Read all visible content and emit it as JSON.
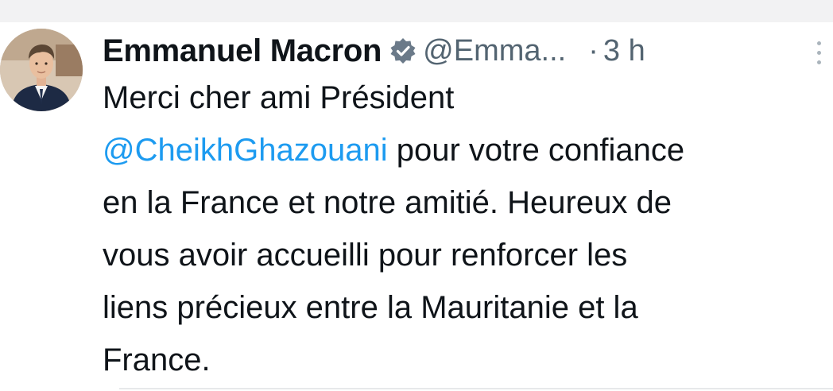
{
  "tweet": {
    "author": {
      "display_name": "Emmanuel Macron",
      "handle": "@Emma",
      "handle_ellipsis": "...",
      "verified": true
    },
    "separator": "·",
    "timestamp": "3 h",
    "text_lines": [
      "Merci cher ami Président",
      "pour votre confiance",
      "en la France et notre amitié. Heureux de",
      "vous avoir accueilli pour renforcer les",
      "liens précieux entre la Mauritanie et la",
      "France."
    ],
    "mention": "@CheikhGhazouani"
  },
  "colors": {
    "text_primary": "#0f1419",
    "text_secondary": "#536471",
    "link": "#1d9bf0",
    "verified_badge": "#6b7a89"
  },
  "icons": {
    "verified": "verified-badge-icon",
    "more": "more-options-icon"
  }
}
